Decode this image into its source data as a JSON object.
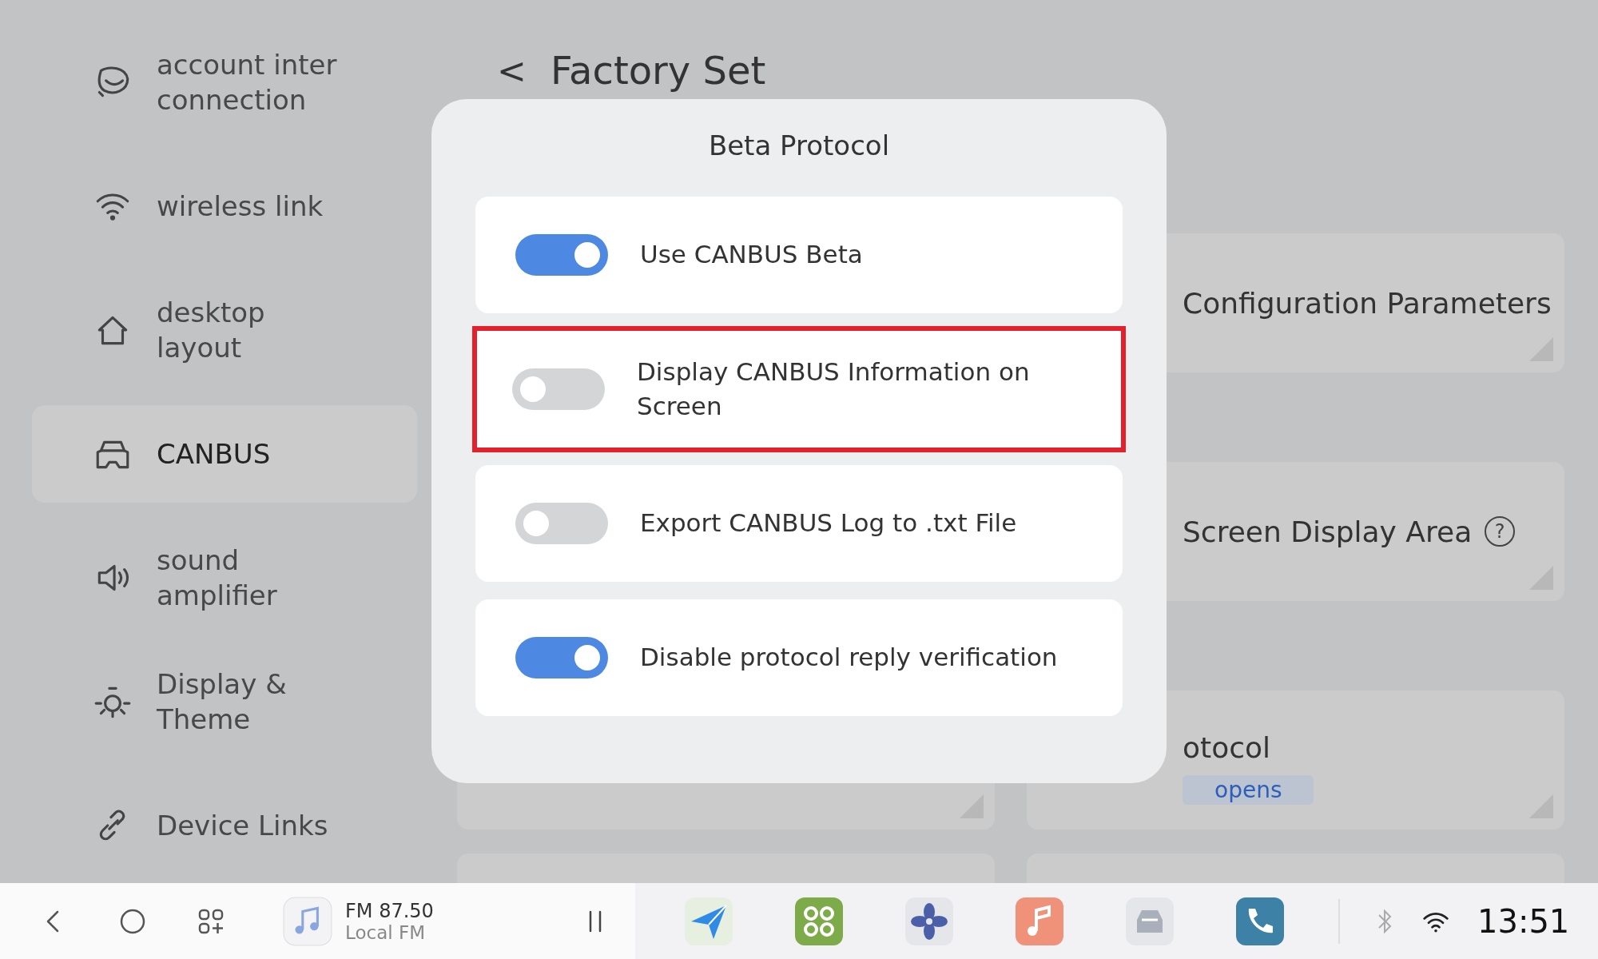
{
  "sidebar": {
    "items": [
      {
        "label": "account inter connection",
        "selected": false
      },
      {
        "label": "wireless link",
        "selected": false
      },
      {
        "label": "desktop layout",
        "selected": false
      },
      {
        "label": "CANBUS",
        "selected": true
      },
      {
        "label": "sound amplifier",
        "selected": false
      },
      {
        "label": "Display & Theme",
        "selected": false
      },
      {
        "label": "Device Links",
        "selected": false
      }
    ]
  },
  "page": {
    "back": "<",
    "title": "Factory Set",
    "cards": [
      {
        "label": "Configuration Parameters"
      },
      {
        "label": "Screen Display Area",
        "help": "?"
      },
      {
        "label": "otocol",
        "tag": "opens"
      }
    ]
  },
  "dialog": {
    "title": "Beta Protocol",
    "options": [
      {
        "label": "Use CANBUS Beta",
        "on": true,
        "highlighted": false
      },
      {
        "label": "Display CANBUS Information on Screen",
        "on": false,
        "highlighted": true
      },
      {
        "label": "Export CANBUS Log to .txt File",
        "on": false,
        "highlighted": false
      },
      {
        "label": "Disable protocol reply verification",
        "on": true,
        "highlighted": false
      }
    ]
  },
  "taskbar": {
    "station": "FM 87.50",
    "source": "Local FM",
    "time": "13:51"
  }
}
